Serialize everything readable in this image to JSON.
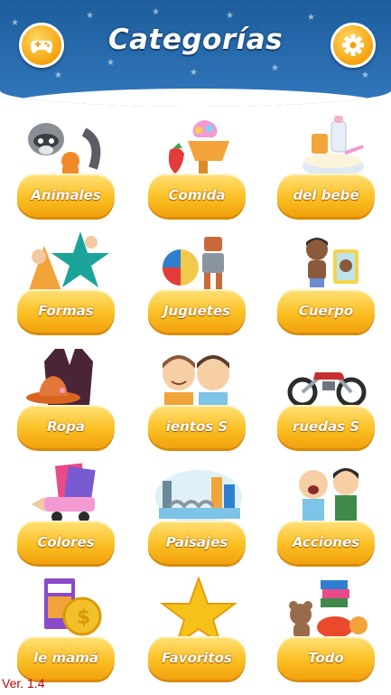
{
  "header": {
    "title": "Categorías",
    "left_button_icon": "gamepad-icon",
    "right_button_icon": "gear-icon",
    "colors": {
      "sky_top": "#1d5d9c",
      "sky_bottom": "#3278bd",
      "accent": "#f6a20e"
    }
  },
  "categories": [
    {
      "label": "Animales",
      "icon": "raccoon-cat-icon"
    },
    {
      "label": "Comida",
      "icon": "ice-cream-strawberry-icon"
    },
    {
      "label": "del bebé",
      "icon": "baby-bottle-bowl-icon"
    },
    {
      "label": "Formas",
      "icon": "shapes-star-icon"
    },
    {
      "label": "Juguetes",
      "icon": "robot-ball-icon"
    },
    {
      "label": "Cuerpo",
      "icon": "boy-mirror-icon"
    },
    {
      "label": "Ropa",
      "icon": "coat-hat-icon"
    },
    {
      "label": "ientos    S",
      "icon": "kids-faces-icon"
    },
    {
      "label": "ruedas    S",
      "icon": "motorcycle-icon"
    },
    {
      "label": "Colores",
      "icon": "pencil-paper-icon"
    },
    {
      "label": "Paisajes",
      "icon": "city-bridge-icon"
    },
    {
      "label": "Acciones",
      "icon": "crying-kids-icon"
    },
    {
      "label": "le mamá",
      "icon": "crayons-coin-icon"
    },
    {
      "label": "Favoritos",
      "icon": "gold-star-icon"
    },
    {
      "label": "Todo",
      "icon": "toys-books-icon"
    }
  ],
  "footer": {
    "version": "Ver. 1.4"
  }
}
